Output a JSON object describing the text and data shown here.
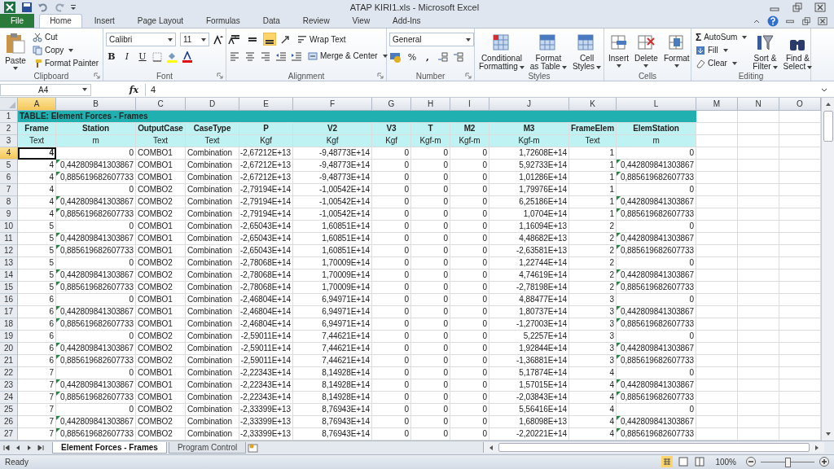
{
  "window": {
    "title": "ATAP KIRI1.xls - Microsoft Excel"
  },
  "ribbon_tabs": [
    {
      "label": "File",
      "kind": "file",
      "selected": false
    },
    {
      "label": "Home",
      "kind": "tab",
      "selected": true
    },
    {
      "label": "Insert",
      "kind": "tab",
      "selected": false
    },
    {
      "label": "Page Layout",
      "kind": "tab",
      "selected": false
    },
    {
      "label": "Formulas",
      "kind": "tab",
      "selected": false
    },
    {
      "label": "Data",
      "kind": "tab",
      "selected": false
    },
    {
      "label": "Review",
      "kind": "tab",
      "selected": false
    },
    {
      "label": "View",
      "kind": "tab",
      "selected": false
    },
    {
      "label": "Add-Ins",
      "kind": "tab",
      "selected": false
    }
  ],
  "clipboard": {
    "label": "Clipboard",
    "paste": "Paste",
    "cut": "Cut",
    "copy": "Copy",
    "format_painter": "Format Painter"
  },
  "font": {
    "label": "Font",
    "font_name": "Calibri",
    "font_size": "11",
    "bold": "B",
    "italic": "I",
    "underline": "U"
  },
  "alignment": {
    "label": "Alignment",
    "vertical_align": [
      {
        "selected": false
      },
      {
        "selected": false
      },
      {
        "selected": true
      }
    ],
    "wrap_text": "Wrap Text",
    "merge_center": "Merge & Center"
  },
  "number": {
    "label": "Number",
    "format": "General",
    "percent": "%",
    "comma": ","
  },
  "styles": {
    "label": "Styles",
    "buttons": [
      "Conditional\nFormatting",
      "Format\nas Table",
      "Cell\nStyles"
    ]
  },
  "cells": {
    "label": "Cells",
    "buttons": [
      "Insert",
      "Delete",
      "Format"
    ]
  },
  "editing": {
    "label": "Editing",
    "autosum_symbol": "Σ",
    "autosum": "AutoSum",
    "fill": "Fill",
    "clear": "Clear",
    "sort_filter": "Sort &\nFilter",
    "find_select": "Find &\nSelect"
  },
  "formula_bar": {
    "name_box": "A4",
    "function_label": "fx",
    "value": "4"
  },
  "sheet": {
    "columns": [
      {
        "letter": "A",
        "selected": true
      },
      {
        "letter": "B",
        "selected": false
      },
      {
        "letter": "C",
        "selected": false
      },
      {
        "letter": "D",
        "selected": false
      },
      {
        "letter": "E",
        "selected": false
      },
      {
        "letter": "F",
        "selected": false
      },
      {
        "letter": "G",
        "selected": false
      },
      {
        "letter": "H",
        "selected": false
      },
      {
        "letter": "I",
        "selected": false
      },
      {
        "letter": "J",
        "selected": false
      },
      {
        "letter": "K",
        "selected": false
      },
      {
        "letter": "L",
        "selected": false
      },
      {
        "letter": "M",
        "selected": false
      },
      {
        "letter": "N",
        "selected": false
      },
      {
        "letter": "O",
        "selected": false
      }
    ],
    "title_row": {
      "number": "1",
      "text": "TABLE:  Element Forces - Frames"
    },
    "header_row": {
      "number": "2",
      "cells": [
        "Frame",
        "Station",
        "OutputCase",
        "CaseType",
        "P",
        "V2",
        "V3",
        "T",
        "M2",
        "M3",
        "FrameElem",
        "ElemStation"
      ]
    },
    "units_row": {
      "number": "3",
      "cells": [
        "Text",
        "m",
        "Text",
        "Text",
        "Kgf",
        "Kgf",
        "Kgf",
        "Kgf-m",
        "Kgf-m",
        "Kgf-m",
        "Text",
        "m"
      ]
    },
    "rows": [
      {
        "number": "4",
        "selected": true,
        "number_as_text": false,
        "cells": [
          "4",
          "0",
          "COMBO1",
          "Combination",
          "-2,67212E+13",
          "-9,48773E+14",
          "0",
          "0",
          "0",
          "1,72608E+14",
          "1",
          "0"
        ]
      },
      {
        "number": "5",
        "selected": false,
        "number_as_text": true,
        "cells": [
          "4",
          "0,442809841303867",
          "COMBO1",
          "Combination",
          "-2,67212E+13",
          "-9,48773E+14",
          "0",
          "0",
          "0",
          "5,92733E+14",
          "1",
          "0,442809841303867"
        ]
      },
      {
        "number": "6",
        "selected": false,
        "number_as_text": true,
        "cells": [
          "4",
          "0,885619682607733",
          "COMBO1",
          "Combination",
          "-2,67212E+13",
          "-9,48773E+14",
          "0",
          "0",
          "0",
          "1,01286E+14",
          "1",
          "0,885619682607733"
        ]
      },
      {
        "number": "7",
        "selected": false,
        "number_as_text": false,
        "cells": [
          "4",
          "0",
          "COMBO2",
          "Combination",
          "-2,79194E+14",
          "-1,00542E+14",
          "0",
          "0",
          "0",
          "1,79976E+14",
          "1",
          "0"
        ]
      },
      {
        "number": "8",
        "selected": false,
        "number_as_text": true,
        "cells": [
          "4",
          "0,442809841303867",
          "COMBO2",
          "Combination",
          "-2,79194E+14",
          "-1,00542E+14",
          "0",
          "0",
          "0",
          "6,25186E+14",
          "1",
          "0,442809841303867"
        ]
      },
      {
        "number": "9",
        "selected": false,
        "number_as_text": true,
        "cells": [
          "4",
          "0,885619682607733",
          "COMBO2",
          "Combination",
          "-2,79194E+14",
          "-1,00542E+14",
          "0",
          "0",
          "0",
          "1,0704E+14",
          "1",
          "0,885619682607733"
        ]
      },
      {
        "number": "10",
        "selected": false,
        "number_as_text": false,
        "cells": [
          "5",
          "0",
          "COMBO1",
          "Combination",
          "-2,65043E+14",
          "1,60851E+14",
          "0",
          "0",
          "0",
          "1,16094E+13",
          "2",
          "0"
        ]
      },
      {
        "number": "11",
        "selected": false,
        "number_as_text": true,
        "cells": [
          "5",
          "0,442809841303867",
          "COMBO1",
          "Combination",
          "-2,65043E+14",
          "1,60851E+14",
          "0",
          "0",
          "0",
          "4,48682E+13",
          "2",
          "0,442809841303867"
        ]
      },
      {
        "number": "12",
        "selected": false,
        "number_as_text": true,
        "cells": [
          "5",
          "0,885619682607733",
          "COMBO1",
          "Combination",
          "-2,65043E+14",
          "1,60851E+14",
          "0",
          "0",
          "0",
          "-2,63581E+13",
          "2",
          "0,885619682607733"
        ]
      },
      {
        "number": "13",
        "selected": false,
        "number_as_text": false,
        "cells": [
          "5",
          "0",
          "COMBO2",
          "Combination",
          "-2,78068E+14",
          "1,70009E+14",
          "0",
          "0",
          "0",
          "1,22744E+14",
          "2",
          "0"
        ]
      },
      {
        "number": "14",
        "selected": false,
        "number_as_text": true,
        "cells": [
          "5",
          "0,442809841303867",
          "COMBO2",
          "Combination",
          "-2,78068E+14",
          "1,70009E+14",
          "0",
          "0",
          "0",
          "4,74619E+14",
          "2",
          "0,442809841303867"
        ]
      },
      {
        "number": "15",
        "selected": false,
        "number_as_text": true,
        "cells": [
          "5",
          "0,885619682607733",
          "COMBO2",
          "Combination",
          "-2,78068E+14",
          "1,70009E+14",
          "0",
          "0",
          "0",
          "-2,78198E+14",
          "2",
          "0,885619682607733"
        ]
      },
      {
        "number": "16",
        "selected": false,
        "number_as_text": false,
        "cells": [
          "6",
          "0",
          "COMBO1",
          "Combination",
          "-2,46804E+14",
          "6,94971E+14",
          "0",
          "0",
          "0",
          "4,88477E+14",
          "3",
          "0"
        ]
      },
      {
        "number": "17",
        "selected": false,
        "number_as_text": true,
        "cells": [
          "6",
          "0,442809841303867",
          "COMBO1",
          "Combination",
          "-2,46804E+14",
          "6,94971E+14",
          "0",
          "0",
          "0",
          "1,80737E+14",
          "3",
          "0,442809841303867"
        ]
      },
      {
        "number": "18",
        "selected": false,
        "number_as_text": true,
        "cells": [
          "6",
          "0,885619682607733",
          "COMBO1",
          "Combination",
          "-2,46804E+14",
          "6,94971E+14",
          "0",
          "0",
          "0",
          "-1,27003E+14",
          "3",
          "0,885619682607733"
        ]
      },
      {
        "number": "19",
        "selected": false,
        "number_as_text": false,
        "cells": [
          "6",
          "0",
          "COMBO2",
          "Combination",
          "-2,59011E+14",
          "7,44621E+14",
          "0",
          "0",
          "0",
          "5,2257E+14",
          "3",
          "0"
        ]
      },
      {
        "number": "20",
        "selected": false,
        "number_as_text": true,
        "cells": [
          "6",
          "0,442809841303867",
          "COMBO2",
          "Combination",
          "-2,59011E+14",
          "7,44621E+14",
          "0",
          "0",
          "0",
          "1,92844E+14",
          "3",
          "0,442809841303867"
        ]
      },
      {
        "number": "21",
        "selected": false,
        "number_as_text": true,
        "cells": [
          "6",
          "0,885619682607733",
          "COMBO2",
          "Combination",
          "-2,59011E+14",
          "7,44621E+14",
          "0",
          "0",
          "0",
          "-1,36881E+14",
          "3",
          "0,885619682607733"
        ]
      },
      {
        "number": "22",
        "selected": false,
        "number_as_text": false,
        "cells": [
          "7",
          "0",
          "COMBO1",
          "Combination",
          "-2,22343E+14",
          "8,14928E+14",
          "0",
          "0",
          "0",
          "5,17874E+14",
          "4",
          "0"
        ]
      },
      {
        "number": "23",
        "selected": false,
        "number_as_text": true,
        "cells": [
          "7",
          "0,442809841303867",
          "COMBO1",
          "Combination",
          "-2,22343E+14",
          "8,14928E+14",
          "0",
          "0",
          "0",
          "1,57015E+14",
          "4",
          "0,442809841303867"
        ]
      },
      {
        "number": "24",
        "selected": false,
        "number_as_text": true,
        "cells": [
          "7",
          "0,885619682607733",
          "COMBO1",
          "Combination",
          "-2,22343E+14",
          "8,14928E+14",
          "0",
          "0",
          "0",
          "-2,03843E+14",
          "4",
          "0,885619682607733"
        ]
      },
      {
        "number": "25",
        "selected": false,
        "number_as_text": false,
        "cells": [
          "7",
          "0",
          "COMBO2",
          "Combination",
          "-2,33399E+13",
          "8,76943E+14",
          "0",
          "0",
          "0",
          "5,56416E+14",
          "4",
          "0"
        ]
      },
      {
        "number": "26",
        "selected": false,
        "number_as_text": true,
        "cells": [
          "7",
          "0,442809841303867",
          "COMBO2",
          "Combination",
          "-2,33399E+13",
          "8,76943E+14",
          "0",
          "0",
          "0",
          "1,68098E+13",
          "4",
          "0,442809841303867"
        ]
      },
      {
        "number": "27",
        "selected": false,
        "number_as_text": true,
        "cells": [
          "7",
          "0,885619682607733",
          "COMBO2",
          "Combination",
          "-2,33399E+13",
          "8,76943E+14",
          "0",
          "0",
          "0",
          "-2,20221E+14",
          "4",
          "0,885619682607733"
        ]
      }
    ]
  },
  "sheet_tabs": [
    {
      "label": "Element Forces - Frames",
      "selected": true
    },
    {
      "label": "Program Control",
      "selected": false
    }
  ],
  "status_bar": {
    "text": "Ready",
    "zoom": "100%",
    "zoom_slider": {
      "level": 0.5
    }
  }
}
